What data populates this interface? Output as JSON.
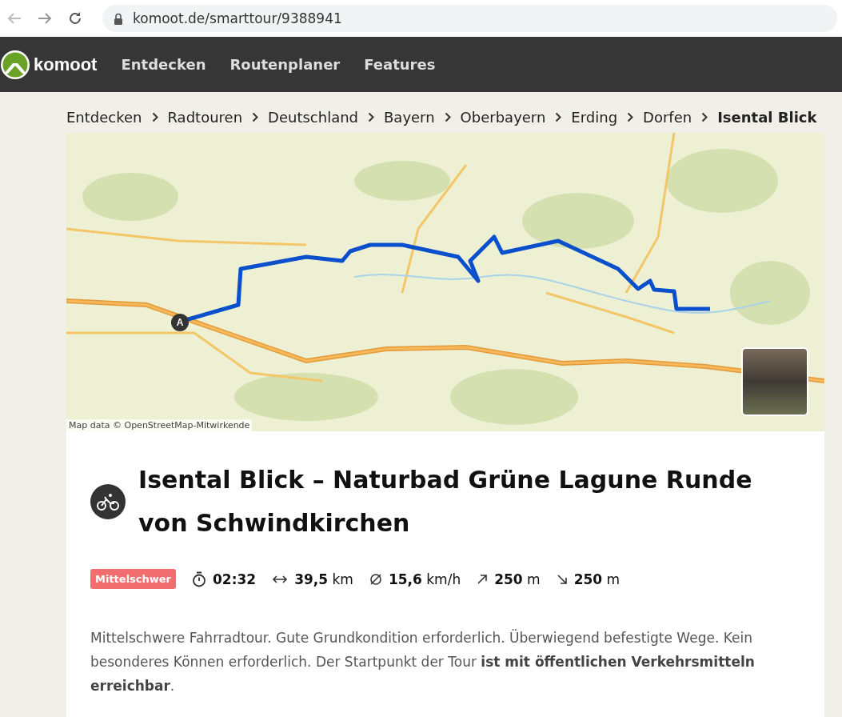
{
  "browser": {
    "url": "komoot.de/smarttour/9388941"
  },
  "nav": {
    "brand": "komoot",
    "links": [
      "Entdecken",
      "Routenplaner",
      "Features"
    ]
  },
  "breadcrumb": [
    {
      "label": "Entdecken",
      "current": false
    },
    {
      "label": "Radtouren",
      "current": false
    },
    {
      "label": "Deutschland",
      "current": false
    },
    {
      "label": "Bayern",
      "current": false
    },
    {
      "label": "Oberbayern",
      "current": false
    },
    {
      "label": "Erding",
      "current": false
    },
    {
      "label": "Dorfen",
      "current": false
    },
    {
      "label": "Isental Blick",
      "current": true
    }
  ],
  "map": {
    "start_marker": "A",
    "attribution": "Map data © OpenStreetMap-Mitwirkende"
  },
  "tour": {
    "title": "Isental Blick – Naturbad Grüne Lagune Runde von Schwindkirchen",
    "difficulty": "Mittelschwer",
    "stats": [
      {
        "kind": "duration",
        "value": "02:32"
      },
      {
        "kind": "distance",
        "value": "39,5",
        "unit": "km"
      },
      {
        "kind": "speed",
        "value": "15,6",
        "unit": "km/h"
      },
      {
        "kind": "uphill",
        "value": "250",
        "unit": "m"
      },
      {
        "kind": "downhill",
        "value": "250",
        "unit": "m"
      }
    ],
    "description": "Mittelschwere Fahrradtour. Gute Grundkondition erforderlich. Überwiegend befestigte Wege. Kein besonderes Können erforderlich. Der Startpunkt der Tour **ist mit öffentlichen Verkehrsmitteln erreichbar**."
  }
}
